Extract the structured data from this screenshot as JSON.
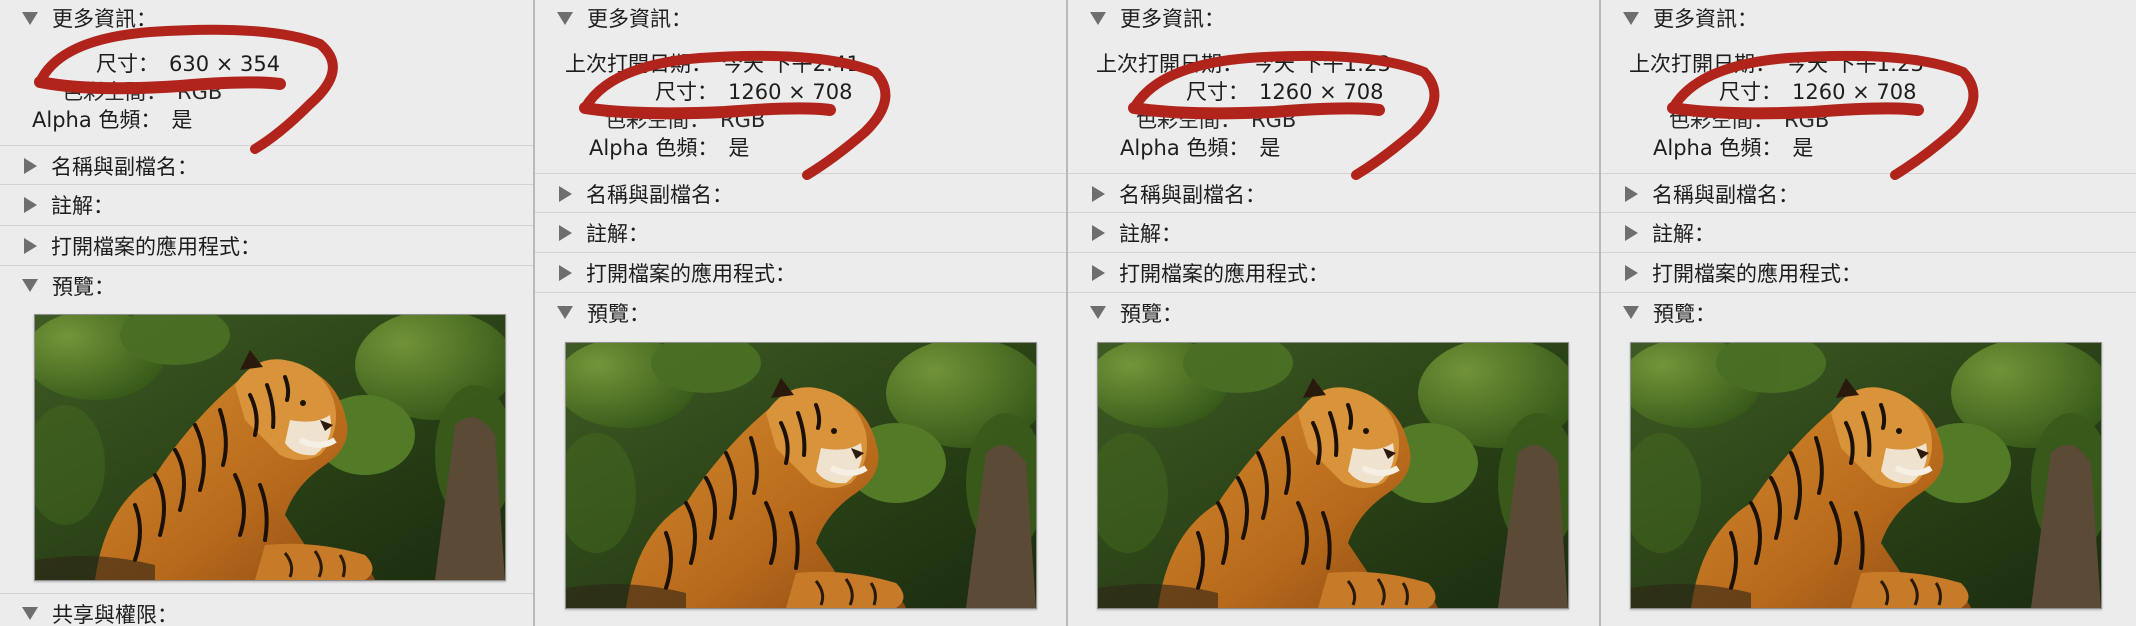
{
  "labels": {
    "more_info": "更多資訊：",
    "name_ext": "名稱與副檔名：",
    "comments": "註解：",
    "open_with": "打開檔案的應用程式：",
    "preview": "預覽：",
    "sharing": "共享與權限：",
    "last_opened_key": "上次打開日期：",
    "dimensions_key": "尺寸：",
    "color_space_key": "色彩空間：",
    "alpha_key": "Alpha 色頻：",
    "alpha_value": "是",
    "color_space_value": "RGB"
  },
  "panels": [
    {
      "dimensions": "630 × 354",
      "last_opened": ""
    },
    {
      "dimensions": "1260 × 708",
      "last_opened": "今天 下午2:41"
    },
    {
      "dimensions": "1260 × 708",
      "last_opened": "今天 下午1:23"
    },
    {
      "dimensions": "1260 × 708",
      "last_opened": "今天 下午1:23"
    }
  ],
  "colors": {
    "background": "#ececec",
    "divider": "#b9b9b9",
    "markup_red": "#b0241c",
    "disclosure_triangle": "#6e6e6e"
  },
  "icons": {
    "expanded": "disclosure-triangle-down-icon",
    "collapsed": "disclosure-triangle-right-icon"
  }
}
